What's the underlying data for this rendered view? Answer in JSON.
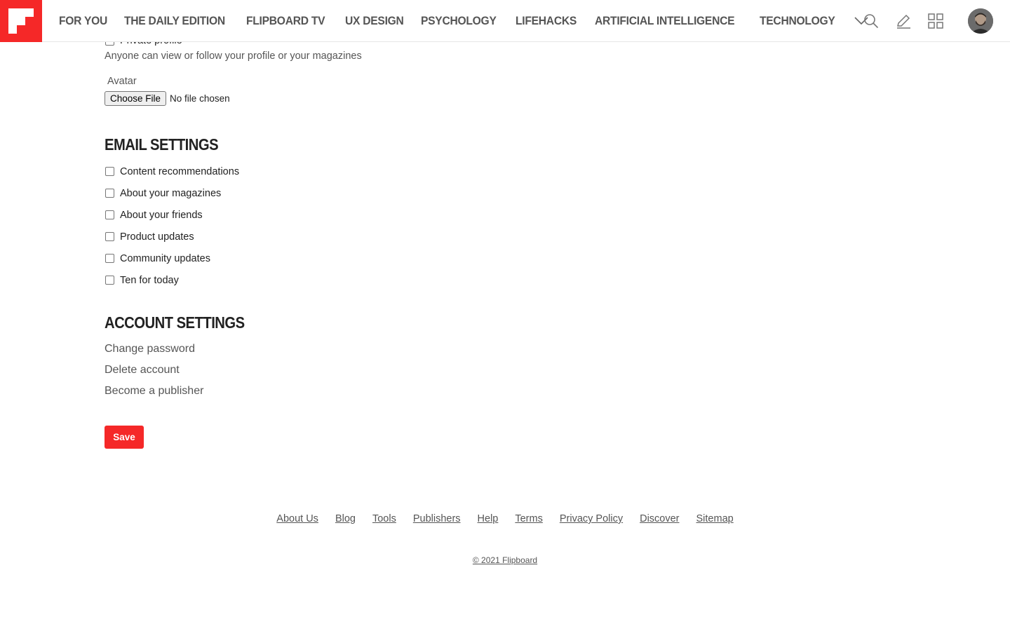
{
  "header": {
    "logo_icon": "flipboard-logo-icon",
    "brand_color": "#f52828",
    "nav_items": [
      {
        "label": "FOR YOU"
      },
      {
        "label": "THE DAILY EDITION"
      },
      {
        "label": "FLIPBOARD TV"
      },
      {
        "label": "UX DESIGN"
      },
      {
        "label": "PSYCHOLOGY"
      },
      {
        "label": "LIFEHACKS"
      },
      {
        "label": "ARTIFICIAL INTELLIGENCE"
      },
      {
        "label": "TECHNOLOGY"
      }
    ],
    "more_icon": "chevron-down-icon",
    "tools": [
      {
        "icon": "search-icon"
      },
      {
        "icon": "pencil-icon"
      },
      {
        "icon": "grid-icon"
      },
      {
        "icon": "avatar"
      }
    ]
  },
  "profile": {
    "private_profile_label": "Private profile",
    "private_profile_checked": false,
    "private_profile_description": "Anyone can view or follow your profile or your magazines",
    "avatar_label": "Avatar",
    "file_button_label": "Choose File",
    "file_status": "No file chosen"
  },
  "email_settings": {
    "title": "EMAIL SETTINGS",
    "options": [
      {
        "label": "Content recommendations",
        "checked": false
      },
      {
        "label": "About your magazines",
        "checked": false
      },
      {
        "label": "About your friends",
        "checked": false
      },
      {
        "label": "Product updates",
        "checked": false
      },
      {
        "label": "Community updates",
        "checked": false
      },
      {
        "label": "Ten for today",
        "checked": false
      }
    ]
  },
  "account_settings": {
    "title": "ACCOUNT SETTINGS",
    "links": [
      {
        "label": "Change password"
      },
      {
        "label": "Delete account"
      },
      {
        "label": "Become a publisher"
      }
    ]
  },
  "save_label": "Save",
  "footer": {
    "links": [
      {
        "label": "About Us"
      },
      {
        "label": "Blog"
      },
      {
        "label": "Tools"
      },
      {
        "label": "Publishers"
      },
      {
        "label": "Help"
      },
      {
        "label": "Terms"
      },
      {
        "label": "Privacy Policy"
      },
      {
        "label": "Discover"
      },
      {
        "label": "Sitemap"
      }
    ],
    "copyright": "© 2021 Flipboard"
  }
}
